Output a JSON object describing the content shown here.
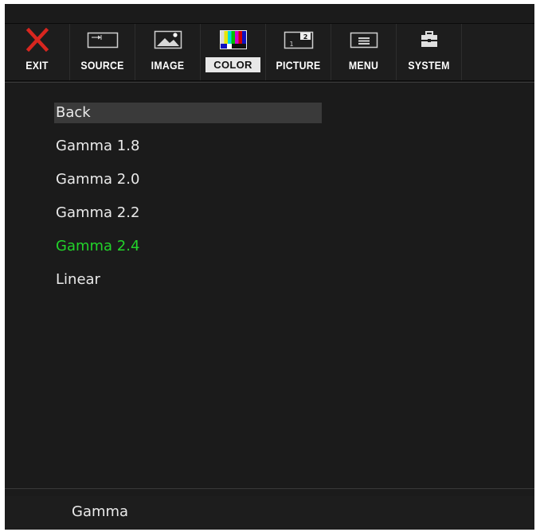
{
  "toolbar": {
    "items": [
      {
        "label": "EXIT",
        "icon": "close-icon"
      },
      {
        "label": "SOURCE",
        "icon": "input-source-icon"
      },
      {
        "label": "IMAGE",
        "icon": "image-icon"
      },
      {
        "label": "COLOR",
        "icon": "color-bars-icon",
        "active": true
      },
      {
        "label": "PICTURE",
        "icon": "picture-in-picture-icon"
      },
      {
        "label": "MENU",
        "icon": "menu-icon"
      },
      {
        "label": "SYSTEM",
        "icon": "system-toolbox-icon"
      }
    ]
  },
  "menu": {
    "items": [
      {
        "label": "Back",
        "state": "focused"
      },
      {
        "label": "Gamma 1.8",
        "state": ""
      },
      {
        "label": "Gamma 2.0",
        "state": ""
      },
      {
        "label": "Gamma 2.2",
        "state": ""
      },
      {
        "label": "Gamma 2.4",
        "state": "selected"
      },
      {
        "label": "Linear",
        "state": ""
      }
    ]
  },
  "status": {
    "title": "Gamma"
  },
  "colors": {
    "background": "#1b1b1b",
    "selected_text": "#22d32a",
    "exit_icon": "#d8261f",
    "active_tab_bg": "#e8e8e8",
    "focus_bg": "#3a3a3a"
  }
}
